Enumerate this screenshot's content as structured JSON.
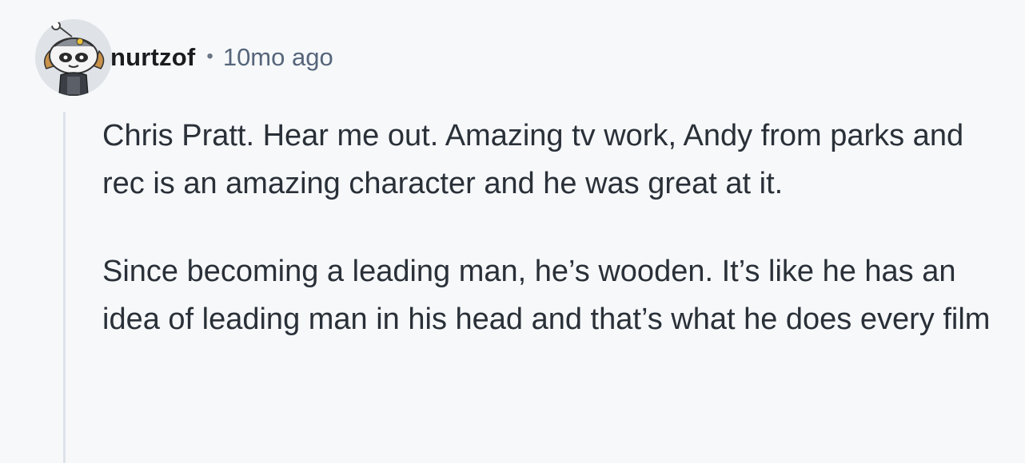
{
  "comment": {
    "author": "nurtzof",
    "separator": "•",
    "timestamp": "10mo ago",
    "avatar_icon": "snoo-avatar-icon",
    "paragraphs": [
      "Chris Pratt. Hear me out. Amazing tv work, Andy from parks and rec is an amazing character and he was great at it.",
      "Since becoming a leading man, he’s wooden. It’s like he has an idea of leading man in his head and that’s what he does every film"
    ]
  },
  "colors": {
    "background": "#f6f8fa",
    "text": "#2a3038",
    "meta": "#56657a",
    "thread_line": "#dde3ea"
  }
}
